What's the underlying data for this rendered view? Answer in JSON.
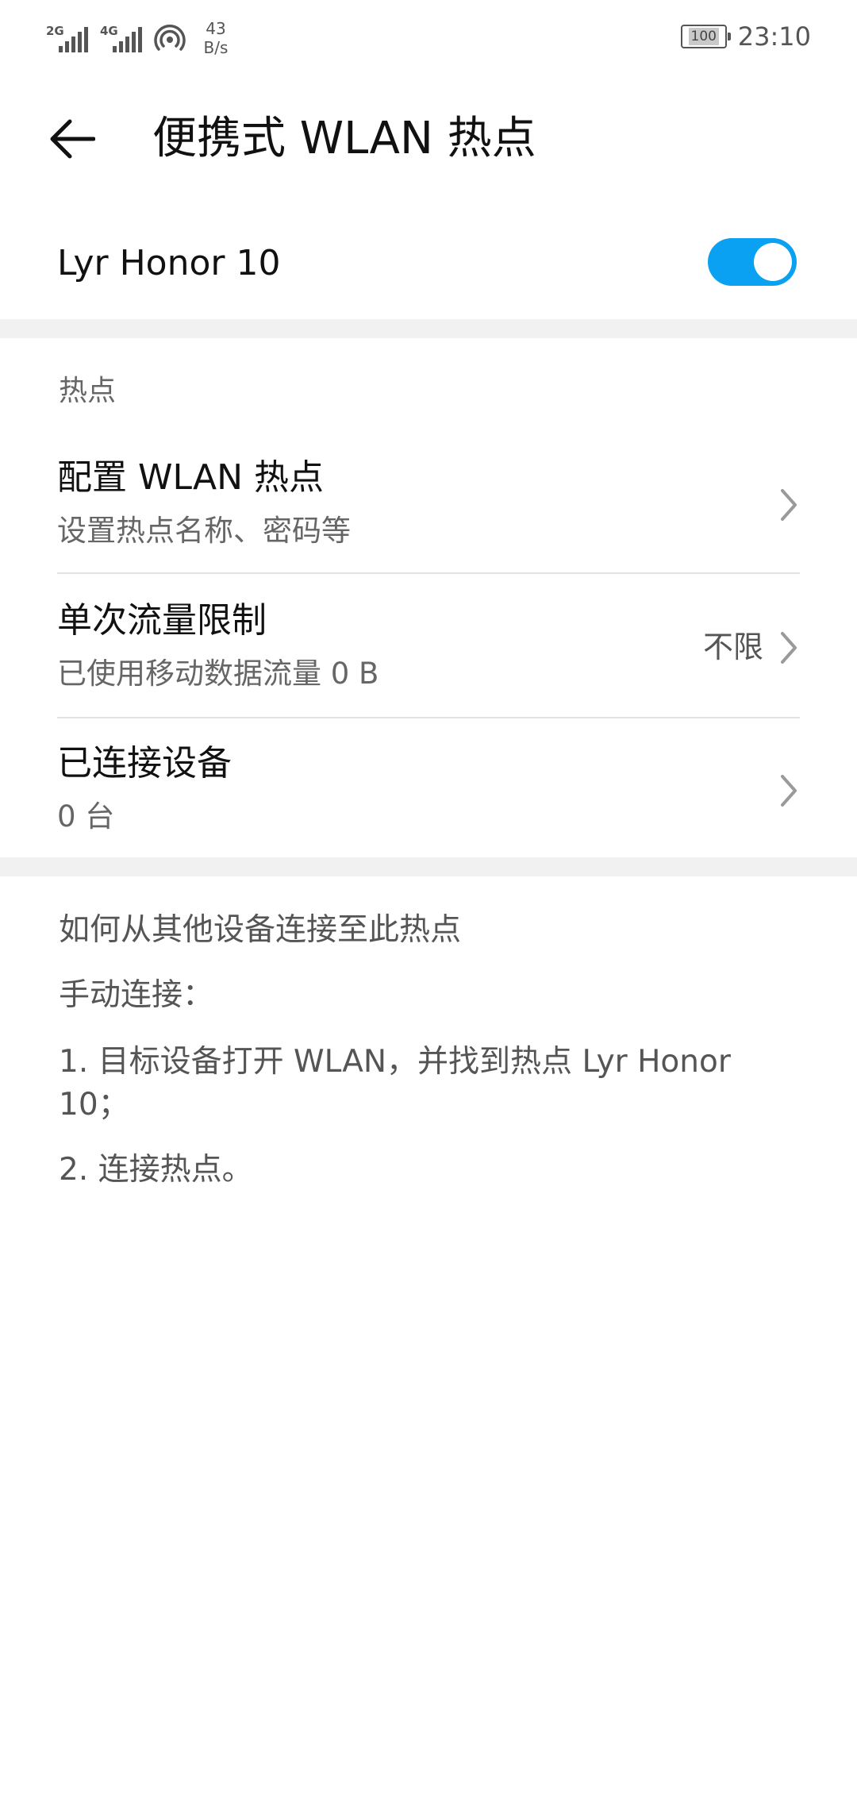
{
  "status_bar": {
    "network1": "2G",
    "network2": "4G",
    "speed_value": "43",
    "speed_unit": "B/s",
    "battery": "100",
    "time": "23:10"
  },
  "header": {
    "back_icon": "arrow-left-icon",
    "title": "便携式 WLAN 热点"
  },
  "hotspot": {
    "name": "Lyr Honor 10",
    "enabled": true,
    "toggle_color": "#0aa1f2"
  },
  "section": {
    "title": "热点"
  },
  "items": [
    {
      "title": "配置 WLAN 热点",
      "subtitle": "设置热点名称、密码等",
      "value": ""
    },
    {
      "title": "单次流量限制",
      "subtitle": "已使用移动数据流量 0 B",
      "value": "不限"
    },
    {
      "title": "已连接设备",
      "subtitle": "0 台",
      "value": ""
    }
  ],
  "help": {
    "title": "如何从其他设备连接至此热点",
    "manual": "手动连接：",
    "step1_line1": "1. 目标设备打开 WLAN，并找到热点 Lyr Honor",
    "step1_line2": "10；",
    "step2": "2. 连接热点。"
  }
}
